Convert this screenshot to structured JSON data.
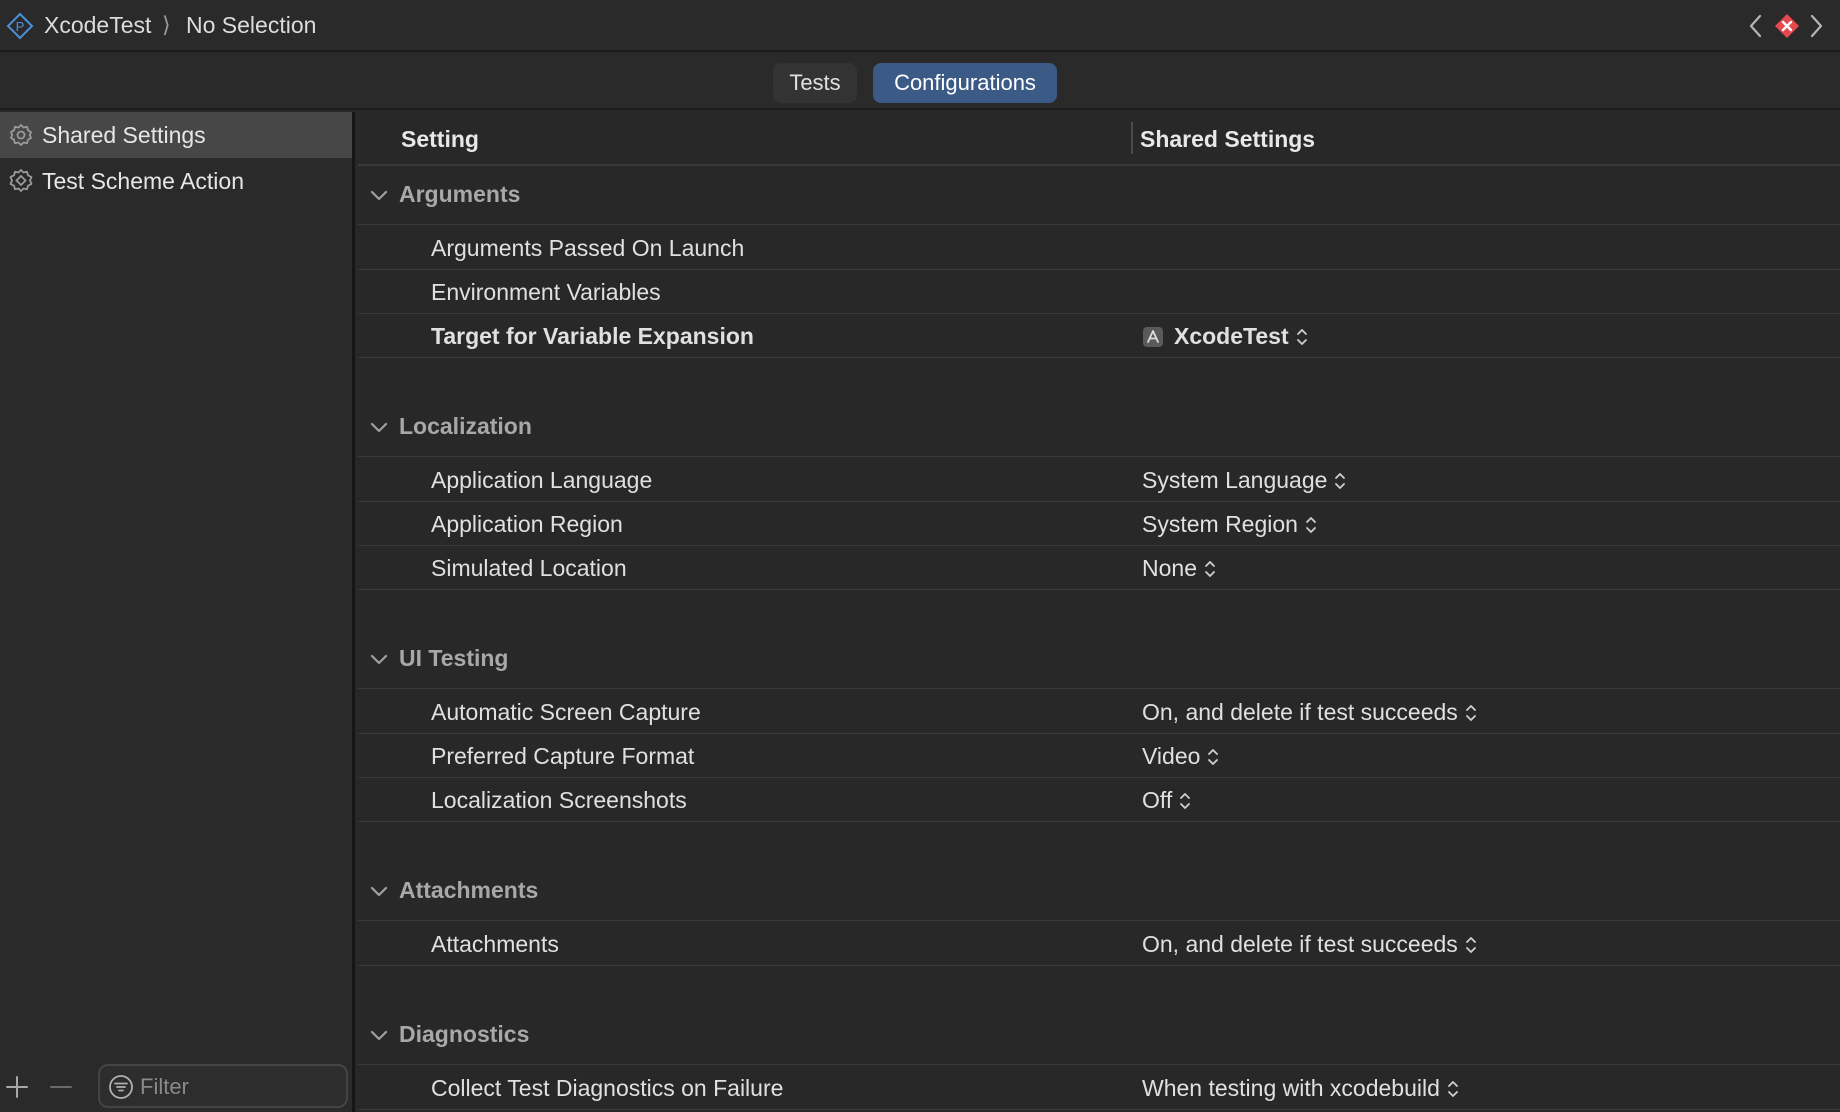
{
  "breadcrumb": {
    "project_icon": "project-icon",
    "project": "XcodeTest",
    "separator": "⟩",
    "selection": "No Selection"
  },
  "nav": {
    "back_icon": "chevron-left-icon",
    "error_icon": "error-icon",
    "forward_icon": "chevron-right-icon",
    "error_color": "#e5484d"
  },
  "tabs": [
    {
      "label": "Tests",
      "selected": false
    },
    {
      "label": "Configurations",
      "selected": true
    }
  ],
  "sidebar": {
    "items": [
      {
        "label": "Shared Settings",
        "icon": "gear-icon",
        "selected": true
      },
      {
        "label": "Test Scheme Action",
        "icon": "target-gear-icon",
        "selected": false
      }
    ],
    "filter_placeholder": "Filter"
  },
  "table": {
    "columns": [
      "Setting",
      "Shared Settings"
    ],
    "sections": [
      {
        "title": "Arguments",
        "rows": [
          {
            "label": "Arguments Passed On Launch",
            "value": ""
          },
          {
            "label": "Environment Variables",
            "value": ""
          },
          {
            "label": "Target for Variable Expansion",
            "value": "XcodeTest",
            "bold": true
          }
        ]
      },
      {
        "title": "Localization",
        "rows": [
          {
            "label": "Application Language",
            "value": "System Language"
          },
          {
            "label": "Application Region",
            "value": "System Region"
          },
          {
            "label": "Simulated Location",
            "value": "None"
          }
        ]
      },
      {
        "title": "UI Testing",
        "rows": [
          {
            "label": "Automatic Screen Capture",
            "value": "On, and delete if test succeeds"
          },
          {
            "label": "Preferred Capture Format",
            "value": "Video"
          },
          {
            "label": "Localization Screenshots",
            "value": "Off"
          }
        ]
      },
      {
        "title": "Attachments",
        "rows": [
          {
            "label": "Attachments",
            "value": "On, and delete if test succeeds"
          }
        ]
      },
      {
        "title": "Diagnostics",
        "rows": [
          {
            "label": "Collect Test Diagnostics on Failure",
            "value": "When testing with xcodebuild"
          }
        ]
      }
    ]
  },
  "colors": {
    "accent": "#3b5b86",
    "background": "#282828",
    "sidebar_selected": "#474747"
  }
}
